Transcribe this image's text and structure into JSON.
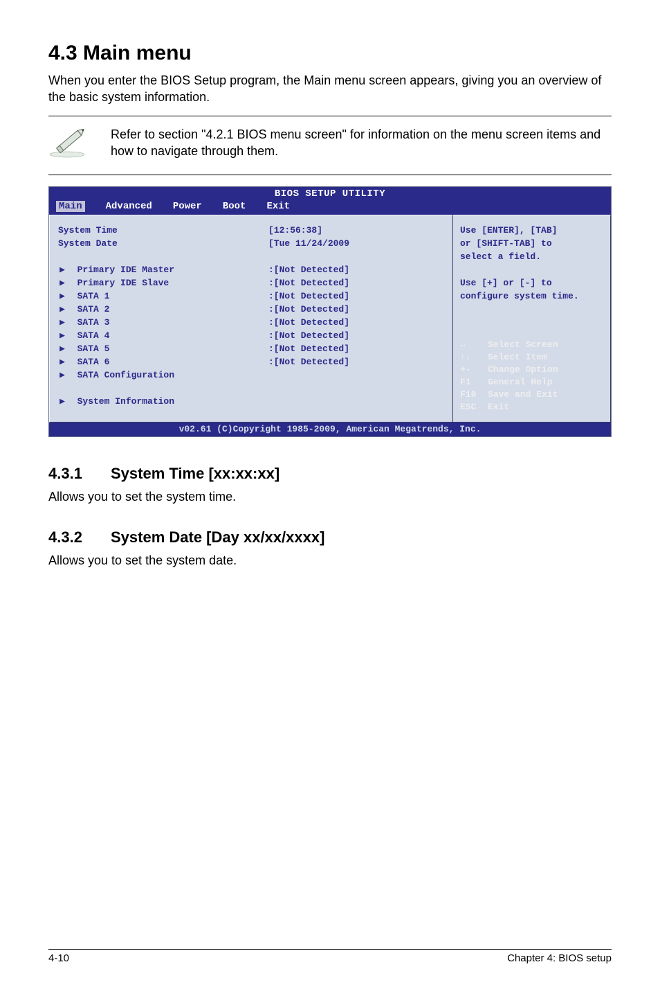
{
  "title": "4.3    Main menu",
  "intro": "When you enter the BIOS Setup program, the Main menu screen appears, giving you an overview of the basic system information.",
  "note": "Refer to section \"4.2.1  BIOS menu screen\" for information on the menu screen items and how to navigate through them.",
  "bios": {
    "header_title": "BIOS SETUP UTILITY",
    "tabs": [
      "Main",
      "Advanced",
      "Power",
      "Boot",
      "Exit"
    ],
    "rows": [
      {
        "label": "System Time",
        "value": "[12:56:38]",
        "arrow": false
      },
      {
        "label": "System Date",
        "value": "[Tue 11/24/2009",
        "arrow": false
      },
      {
        "label": "",
        "value": "",
        "arrow": false
      },
      {
        "label": "Primary IDE Master",
        "value": ":[Not Detected]",
        "arrow": true
      },
      {
        "label": "Primary IDE Slave",
        "value": ":[Not Detected]",
        "arrow": true
      },
      {
        "label": "SATA 1",
        "value": ":[Not Detected]",
        "arrow": true
      },
      {
        "label": "SATA 2",
        "value": ":[Not Detected]",
        "arrow": true
      },
      {
        "label": "SATA 3",
        "value": ":[Not Detected]",
        "arrow": true
      },
      {
        "label": "SATA 4",
        "value": ":[Not Detected]",
        "arrow": true
      },
      {
        "label": "SATA 5",
        "value": ":[Not Detected]",
        "arrow": true
      },
      {
        "label": "SATA 6",
        "value": ":[Not Detected]",
        "arrow": true
      },
      {
        "label": "SATA Configuration",
        "value": "",
        "arrow": true
      },
      {
        "label": "",
        "value": "",
        "arrow": false
      },
      {
        "label": "System Information",
        "value": "",
        "arrow": true
      }
    ],
    "help_upper": [
      "Use [ENTER], [TAB]",
      "or [SHIFT-TAB] to",
      "select a field.",
      "",
      "Use [+] or [-] to",
      "configure system time."
    ],
    "help_nav": [
      {
        "key": "↔",
        "desc": "Select Screen"
      },
      {
        "key": "↑↓",
        "desc": "Select Item"
      },
      {
        "key": "+-",
        "desc": "Change Option"
      },
      {
        "key": "F1",
        "desc": "General Help"
      },
      {
        "key": "F10",
        "desc": "Save and Exit"
      },
      {
        "key": "ESC",
        "desc": "Exit"
      }
    ],
    "footer": "v02.61 (C)Copyright 1985-2009, American Megatrends, Inc."
  },
  "subsections": [
    {
      "num": "4.3.1",
      "title": "System Time [xx:xx:xx]",
      "body": "Allows you to set the system time."
    },
    {
      "num": "4.3.2",
      "title": "System Date [Day xx/xx/xxxx]",
      "body": "Allows you to set the system date."
    }
  ],
  "footer": {
    "left": "4-10",
    "right": "Chapter 4: BIOS setup"
  }
}
